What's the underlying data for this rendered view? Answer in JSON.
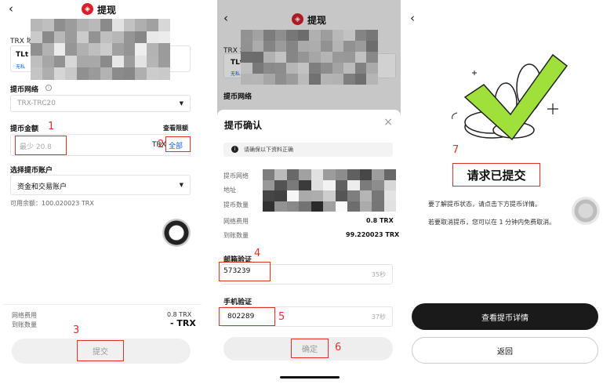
{
  "screen1": {
    "back": "‹",
    "title": "提现",
    "addr_label": "TRX 地",
    "addr_value": "TLt",
    "addr_tag": "无私",
    "network_label": "提币网络",
    "network_value": "TRX-TRC20",
    "amount_label": "提币金额",
    "amount_link": "查看限额",
    "amount_placeholder": "最少 20.8",
    "amount_unit": "TRX",
    "all_button": "全部",
    "account_label": "选择提币账户",
    "account_value": "资金和交易账户",
    "balance": "可用余额：100.020023 TRX",
    "fee_label": "网络费用",
    "fee_value": "0.8 TRX",
    "received_label": "到账数量",
    "received_value": "- TRX",
    "submit_button": "提交"
  },
  "screen2": {
    "back": "‹",
    "title": "提现",
    "addr_label": "TRX 地",
    "addr_value": "TLt",
    "addr_tag": "无私",
    "network_label": "提币网络",
    "modal_title": "提币确认",
    "close": "×",
    "notice": "请确保以下资料正确",
    "row_network": "提币网络",
    "row_address": "地址",
    "row_amount": "提币数量",
    "row_fee": "网络费用",
    "row_fee_value": "0.8 TRX",
    "row_received": "到账数量",
    "row_received_value": "99.220023 TRX",
    "email_label": "邮箱验证",
    "email_code": "573239",
    "email_timer": "35秒",
    "phone_label": "手机验证",
    "phone_code": "802289",
    "phone_timer": "37秒",
    "confirm_button": "确定"
  },
  "screen3": {
    "back": "‹",
    "heading": "请求已提交",
    "desc1": "要了解提币状态，请点击下方提币详情。",
    "desc2": "若要取消提币，您可以在 1 分钟内免费取消。",
    "details_button": "查看提币详情",
    "return_button": "返回"
  },
  "annotations": [
    "1",
    "2",
    "3",
    "4",
    "5",
    "6",
    "7"
  ],
  "colors": {
    "accent_red": "#e0302a",
    "brand_red": "#d6202a",
    "check_green": "#9fe03a",
    "link_blue": "#1a5fd6"
  }
}
